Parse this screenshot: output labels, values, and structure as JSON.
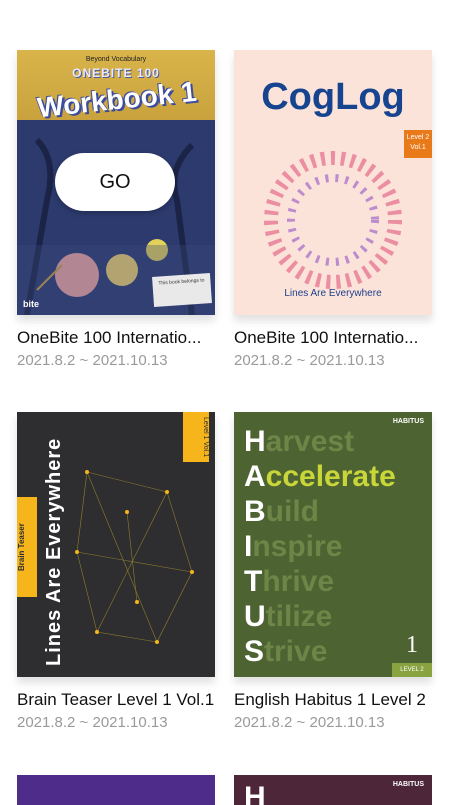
{
  "cards": [
    {
      "title": "OneBite 100 Internatio...",
      "date": "2021.8.2 ~ 2021.10.13",
      "go_label": "GO",
      "cover": {
        "subtitle": "Beyond Vocabulary",
        "brand": "ONEBITE 100",
        "name": "Workbook 1",
        "logo": "bite",
        "note": "This book belongs to"
      }
    },
    {
      "title": "OneBite 100 Internatio...",
      "date": "2021.8.2 ~ 2021.10.13",
      "cover": {
        "name": "CogLog",
        "level": "Level 2",
        "volume": "Vol.1",
        "tagline": "Lines Are Everywhere"
      }
    },
    {
      "title": "Brain Teaser Level 1 Vol.1",
      "date": "2021.8.2 ~ 2021.10.13",
      "cover": {
        "name": "Lines Are Everywhere",
        "series": "Brain Teaser",
        "level": "Level 1 Vol.1"
      }
    },
    {
      "title": "English Habitus 1 Level 2",
      "date": "2021.8.2 ~ 2021.10.13",
      "cover": {
        "brand": "HABITUS",
        "words": [
          "Harvest",
          "Accelerate",
          "Build",
          "Inspire",
          "Thrive",
          "Utilize",
          "Strive"
        ],
        "number": "1",
        "level": "LEVEL 2"
      }
    }
  ],
  "partial_cards": [
    {
      "color": "#4e2d8a"
    },
    {
      "brand": "HABITUS",
      "initial": "H",
      "color": "#4d2739"
    }
  ]
}
